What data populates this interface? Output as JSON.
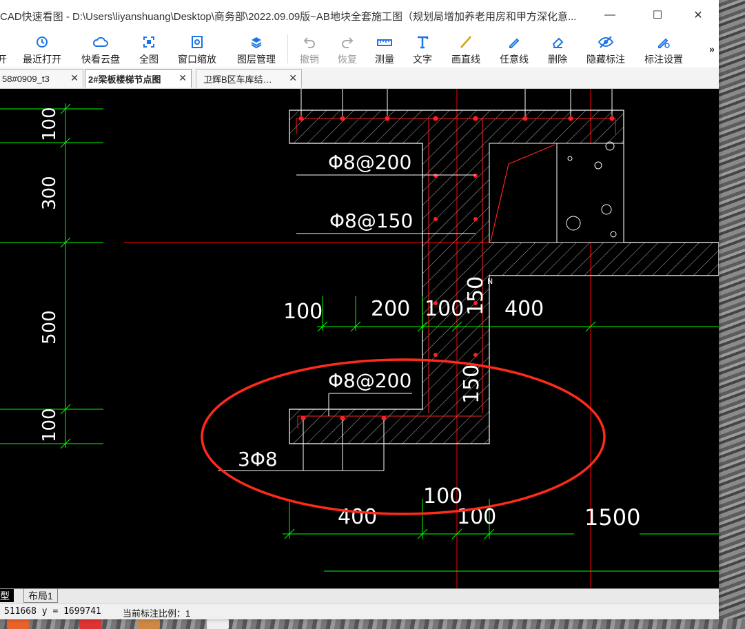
{
  "window": {
    "title": "CAD快速看图 - D:\\Users\\liyanshuang\\Desktop\\商务部\\2022.09.09版~AB地块全套施工图（规划局增加养老用房和甲方深化意...",
    "minimize": "—",
    "maximize": "☐",
    "close": "✕"
  },
  "toolbar": {
    "items": [
      {
        "label": "开",
        "icon": "open-icon"
      },
      {
        "label": "最近打开",
        "icon": "recent-icon"
      },
      {
        "label": "快看云盘",
        "icon": "cloud-icon"
      },
      {
        "label": "全图",
        "icon": "fit-icon"
      },
      {
        "label": "窗口缩放",
        "icon": "zoom-window-icon"
      },
      {
        "label": "图层管理",
        "icon": "layers-icon"
      },
      {
        "label": "撤销",
        "icon": "undo-icon"
      },
      {
        "label": "恢复",
        "icon": "redo-icon"
      },
      {
        "label": "测量",
        "icon": "measure-icon"
      },
      {
        "label": "文字",
        "icon": "text-icon"
      },
      {
        "label": "画直线",
        "icon": "line-icon"
      },
      {
        "label": "任意线",
        "icon": "freehand-icon"
      },
      {
        "label": "删除",
        "icon": "eraser-icon"
      },
      {
        "label": "隐藏标注",
        "icon": "eye-icon"
      },
      {
        "label": "标注设置",
        "icon": "annotation-settings-icon"
      }
    ],
    "more": "»"
  },
  "tabs": [
    {
      "label": "58#0909_t3",
      "close": "✕"
    },
    {
      "label": "2#梁板楼梯节点图",
      "close": "✕"
    },
    {
      "label": "卫辉B区车库结…",
      "close": "✕"
    }
  ],
  "drawing": {
    "dims_left": [
      "100",
      "300",
      "500",
      "100"
    ],
    "dims_mid": [
      "100",
      "200",
      "100",
      "150",
      "400",
      "150"
    ],
    "dims_bottom": [
      "100",
      "400",
      "100",
      "1500"
    ],
    "rebar_labels": [
      "Φ8@200",
      "Φ8@150",
      "Φ8@200",
      "3Φ8"
    ],
    "small_mark": "N",
    "colors": {
      "dim": "#00ff00",
      "axis": "#ff0000",
      "line": "#ffffff",
      "highlight": "#ff2a1a"
    }
  },
  "layout_tabs": [
    "型",
    "布局1"
  ],
  "status": {
    "coords": "511668 y = 1699741",
    "scale": "当前标注比例：1"
  }
}
